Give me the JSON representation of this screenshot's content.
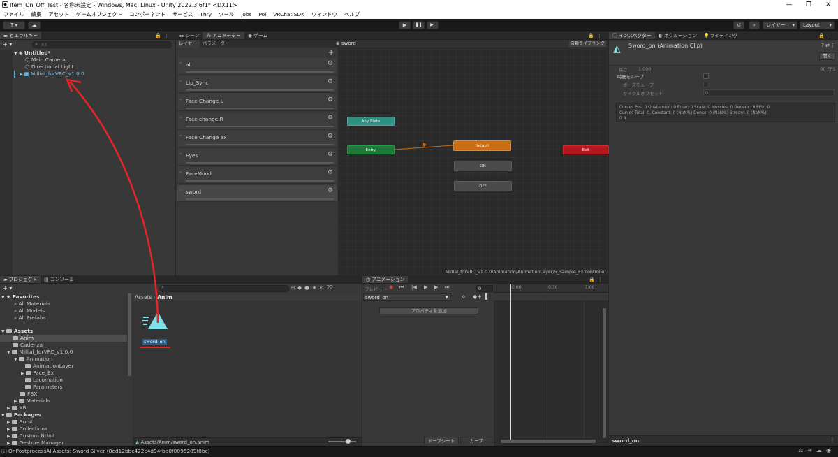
{
  "window": {
    "title": "Item_On_Off_Test - 名称未設定 - Windows, Mac, Linux - Unity 2022.3.6f1* <DX11>",
    "controls": [
      "—",
      "❐",
      "✕"
    ]
  },
  "menu": [
    "ファイル",
    "編集",
    "アセット",
    "ゲームオブジェクト",
    "コンポーネント",
    "サービス",
    "Thry",
    "ツール",
    "Jobs",
    "Poi",
    "VRChat SDK",
    "ウィンドウ",
    "ヘルプ"
  ],
  "toolbar": {
    "account": "T ▾",
    "play": "▶",
    "pause": "❚❚",
    "step": "▶|",
    "layers": "レイヤー",
    "layout": "Layout"
  },
  "hierarchy": {
    "tab": "ヒエラルキー",
    "search_placeholder": "All",
    "add": "+ ▾",
    "rows": [
      {
        "label": "Untitled*",
        "indent": 0,
        "bold": true
      },
      {
        "label": "Main Camera",
        "indent": 1
      },
      {
        "label": "Directional Light",
        "indent": 1
      },
      {
        "label": "Millial_forVRC_v1.0.0",
        "indent": 1,
        "selected": true
      }
    ]
  },
  "animator": {
    "tabs": [
      "シーン",
      "アニメーター",
      "ゲーム"
    ],
    "subtabs": [
      "レイヤー",
      "パラメーター"
    ],
    "breadcrumb": "sword",
    "auto_layout": "自動ライブリンク",
    "layers": [
      "all",
      "Lip_Sync",
      "Face Change L",
      "Face change R",
      "Face Change ex",
      "Eyes",
      "FaceMood",
      "sword"
    ],
    "nodes": {
      "any_state": "Any State",
      "entry": "Entry",
      "default": "Default",
      "exit": "Exit",
      "on": "ON",
      "off": "OFF"
    },
    "path": "Millial_forVRC_v1.0.0/Animation/AnimationLayer/5_Sample_Fx.controller"
  },
  "inspector": {
    "tabs": [
      "インスペクター",
      "オクルージョン",
      "ライティング"
    ],
    "title": "Sword_on (Animation Clip)",
    "open_btn": "開く",
    "length_label": "長さ",
    "length_value": "1.000",
    "fps": "60 FPS",
    "loop_time": "時間をループ",
    "loop_pose": "ポーズをループ",
    "cycle_offset": "サイクルオフセット",
    "cycle_value": "0",
    "curves1": "Curves Pos: 0 Quaternion: 0 Euler: 0 Scale: 0 Muscles: 0 Generic: 0 PPtr: 0",
    "curves2": "Curves Total: 0, Constant: 0 (NaN%) Dense: 0 (NaN%) Stream: 0 (NaN%)",
    "curves3": "0 B",
    "footer": "sword_on"
  },
  "project": {
    "tabs": [
      "プロジェクト",
      "コンソール"
    ],
    "add": "+ ▾",
    "count": "22",
    "breadcrumb": {
      "root": "Assets",
      "current": "Anim"
    },
    "tree": [
      {
        "label": "Favorites",
        "indent": 0,
        "bold": true,
        "icon": "star"
      },
      {
        "label": "All Materials",
        "indent": 1,
        "icon": "search"
      },
      {
        "label": "All Models",
        "indent": 1,
        "icon": "search"
      },
      {
        "label": "All Prefabs",
        "indent": 1,
        "icon": "search"
      },
      {
        "label": "",
        "indent": 0
      },
      {
        "label": "Assets",
        "indent": 0,
        "bold": true,
        "icon": "folder"
      },
      {
        "label": "Anim",
        "indent": 1,
        "icon": "folder",
        "selected": true
      },
      {
        "label": "Cadenza",
        "indent": 1,
        "icon": "folder"
      },
      {
        "label": "Millial_forVRC_v1.0.0",
        "indent": 1,
        "icon": "folder"
      },
      {
        "label": "Animation",
        "indent": 2,
        "icon": "folder"
      },
      {
        "label": "AnimationLayer",
        "indent": 3,
        "icon": "folder"
      },
      {
        "label": "Face_Ex",
        "indent": 3,
        "icon": "folder"
      },
      {
        "label": "Locomotion",
        "indent": 3,
        "icon": "folder"
      },
      {
        "label": "Parameters",
        "indent": 3,
        "icon": "folder"
      },
      {
        "label": "FBX",
        "indent": 2,
        "icon": "folder"
      },
      {
        "label": "Materials",
        "indent": 2,
        "icon": "folder"
      },
      {
        "label": "XR",
        "indent": 1,
        "icon": "folder"
      },
      {
        "label": "Packages",
        "indent": 0,
        "bold": true,
        "icon": "folder"
      },
      {
        "label": "Burst",
        "indent": 1,
        "icon": "folder"
      },
      {
        "label": "Collections",
        "indent": 1,
        "icon": "folder"
      },
      {
        "label": "Custom NUnit",
        "indent": 1,
        "icon": "folder"
      },
      {
        "label": "Gesture Manager",
        "indent": 1,
        "icon": "folder"
      }
    ],
    "asset": "sword_on",
    "asset_path": "Assets/Anim/sword_on.anim"
  },
  "animation": {
    "tab": "アニメーション",
    "preview": "プレビュー",
    "frame": "0",
    "clip": "sword_on",
    "add_property": "プロパティを追加",
    "dopesheet": "ドープシート",
    "curves": "カーブ",
    "ticks": [
      "0:00",
      "0:30",
      "1:00"
    ]
  },
  "status": {
    "message": "OnPostprocessAllAssets: Sword Silver (8ed12bbc422c4d94fbd0f0095289f8bc)"
  },
  "colors": {
    "annotation": "#e8242b",
    "accent": "#2c5d87",
    "selected_text": "#7bc4f0",
    "default_node": "#c96d12",
    "entry_node": "#1f7a3a",
    "any_node": "#2e8f82",
    "exit_node": "#b3181e"
  }
}
